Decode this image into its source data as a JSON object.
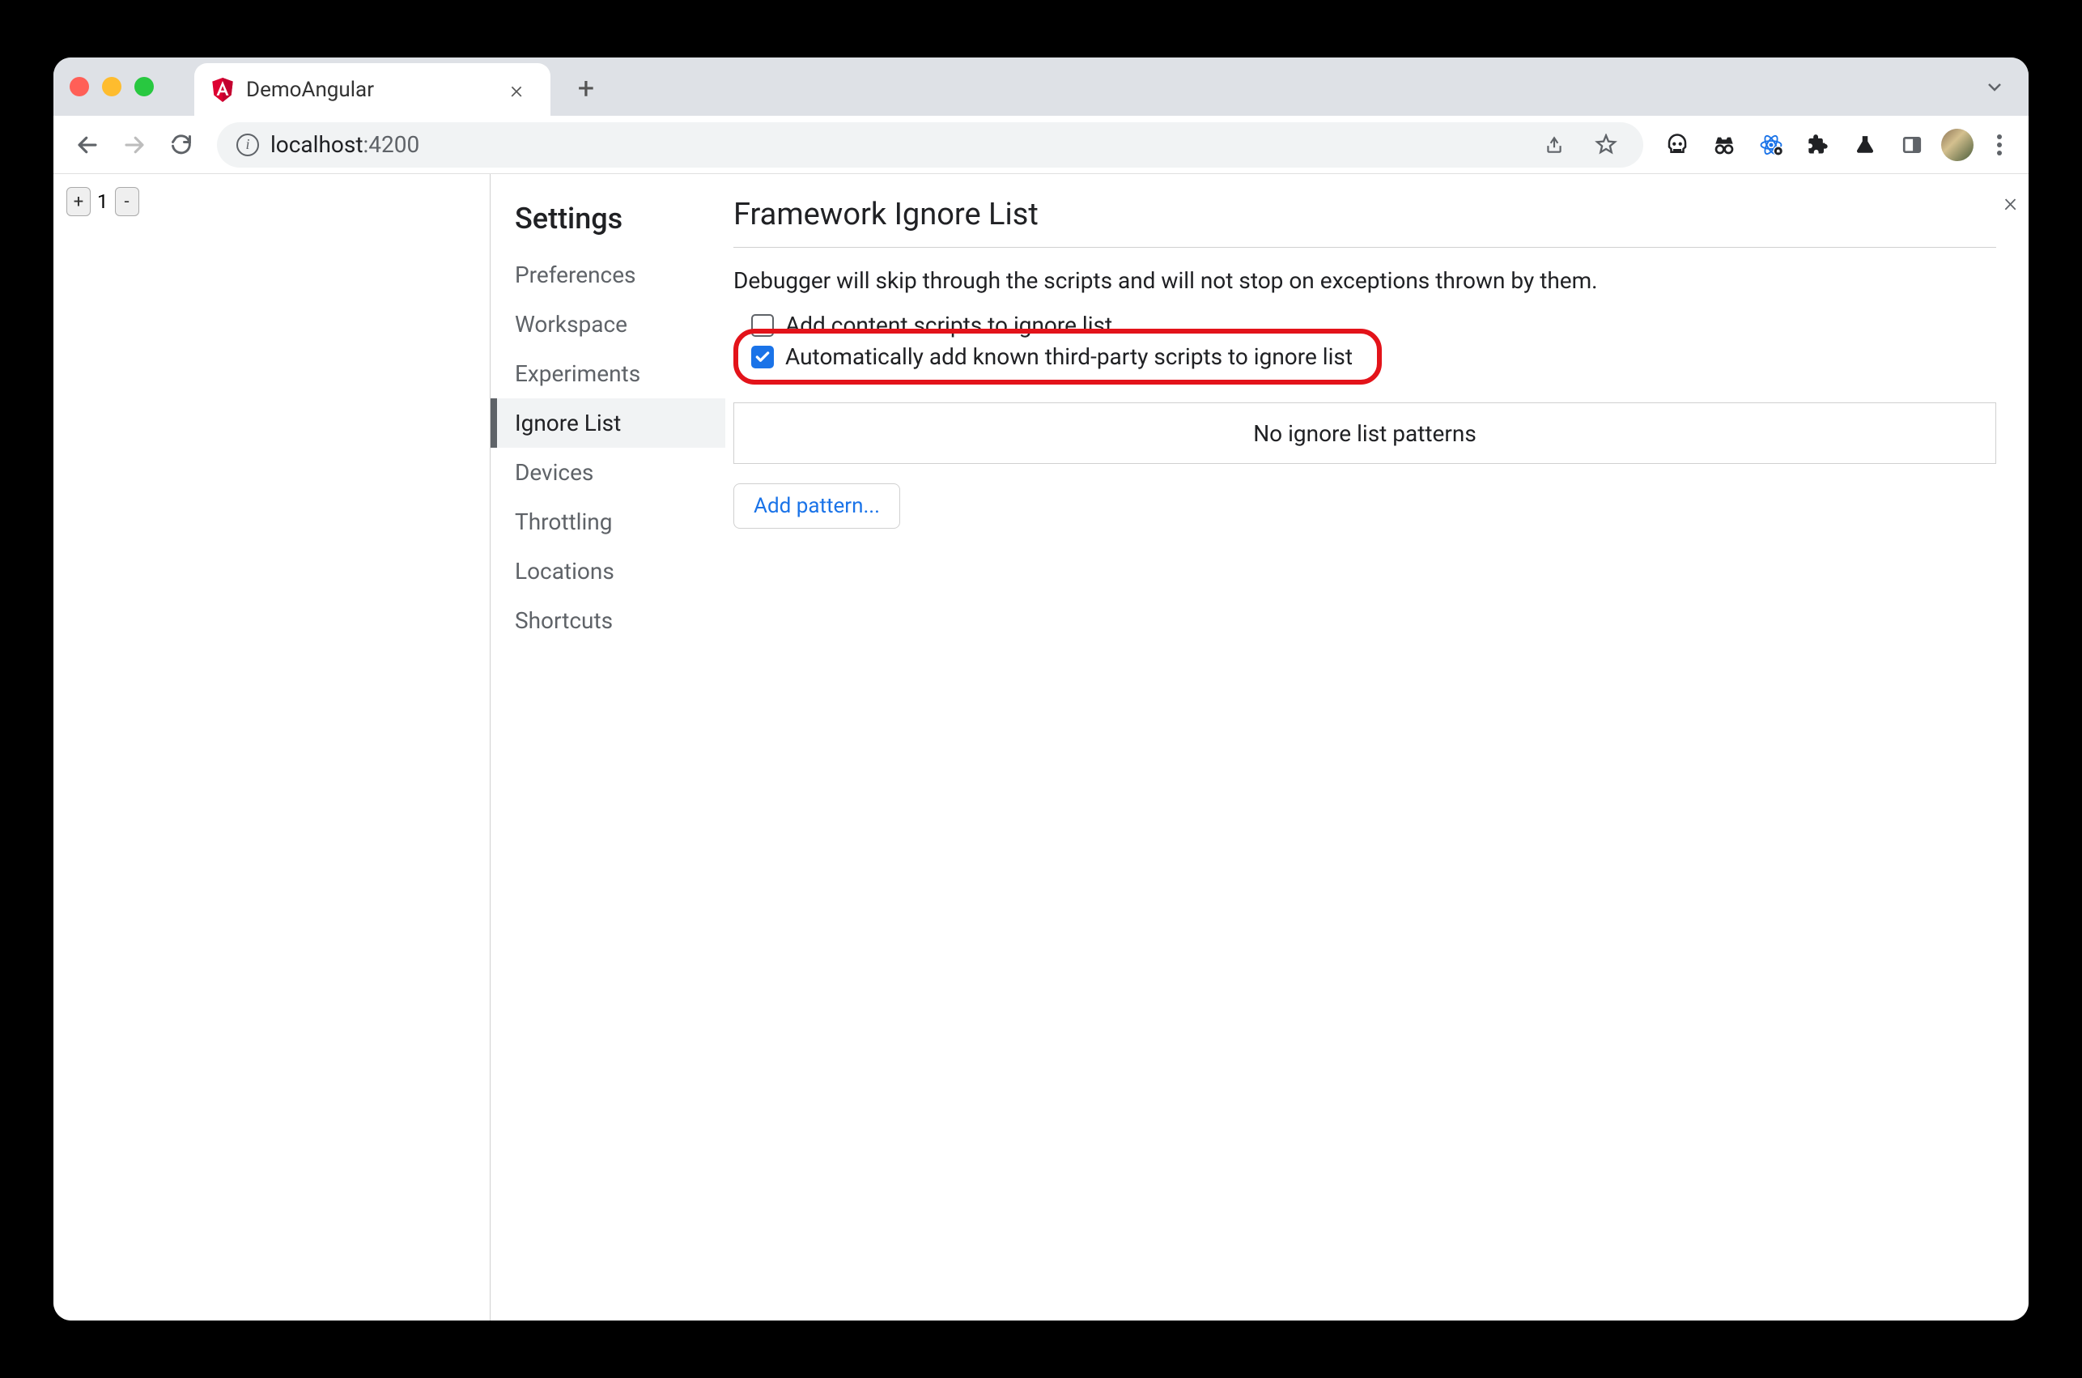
{
  "tab": {
    "title": "DemoAngular"
  },
  "url": {
    "host": "localhost",
    "port": ":4200"
  },
  "page": {
    "counter": {
      "plus": "+",
      "minus": "-",
      "value": "1"
    }
  },
  "settings": {
    "heading": "Settings",
    "items": [
      {
        "label": "Preferences"
      },
      {
        "label": "Workspace"
      },
      {
        "label": "Experiments"
      },
      {
        "label": "Ignore List",
        "active": true
      },
      {
        "label": "Devices"
      },
      {
        "label": "Throttling"
      },
      {
        "label": "Locations"
      },
      {
        "label": "Shortcuts"
      }
    ]
  },
  "main": {
    "title": "Framework Ignore List",
    "description": "Debugger will skip through the scripts and will not stop on exceptions thrown by them.",
    "checkbox1": {
      "label": "Add content scripts to ignore list",
      "checked": false
    },
    "checkbox2": {
      "label": "Automatically add known third-party scripts to ignore list",
      "checked": true
    },
    "empty_patterns": "No ignore list patterns",
    "add_pattern": "Add pattern..."
  }
}
